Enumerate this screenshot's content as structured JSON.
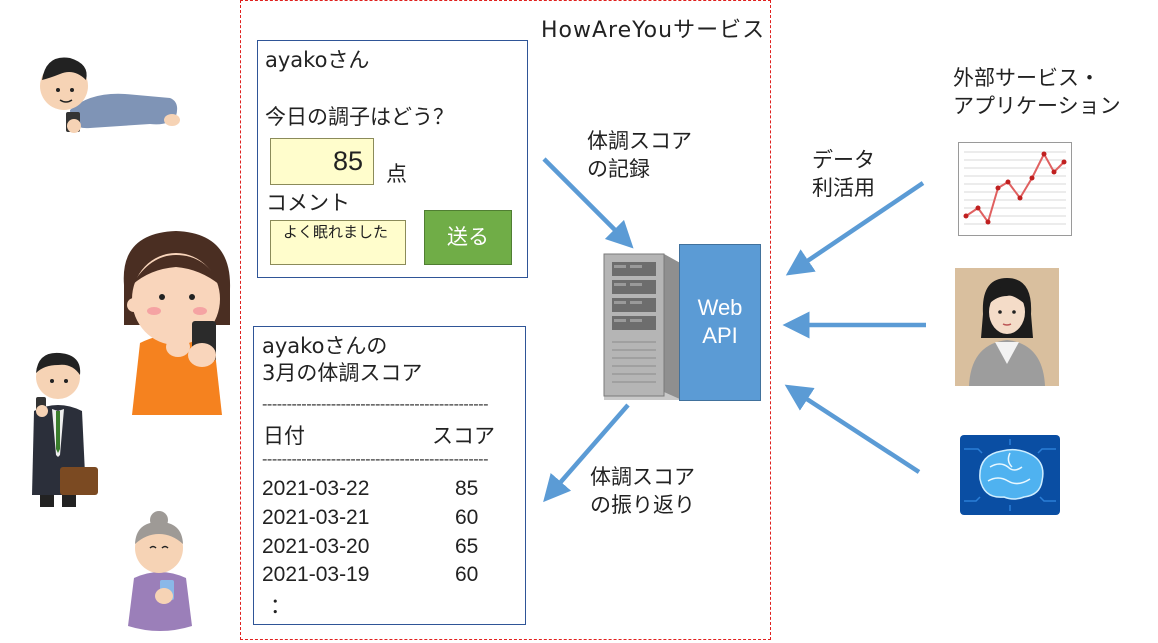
{
  "service": {
    "title": "HowAreYouサービス"
  },
  "input_form": {
    "greeting": "ayakoさん",
    "question": "今日の調子はどう？",
    "score_value": "85",
    "score_unit": "点",
    "comment_label": "コメント",
    "comment_value": "よく眠れました",
    "send_label": "送る"
  },
  "history": {
    "title": "ayakoさんの\n3月の体調スコア",
    "divider": "----------------------------------------------",
    "col_date": "日付",
    "col_score": "スコア",
    "rows": [
      {
        "date": "2021-03-22",
        "score": "85"
      },
      {
        "date": "2021-03-21",
        "score": "60"
      },
      {
        "date": "2021-03-20",
        "score": "65"
      },
      {
        "date": "2021-03-19",
        "score": "60"
      }
    ],
    "more": "："
  },
  "server": {
    "label": "Web\nAPI"
  },
  "flows": {
    "record": "体調スコア\nの記録",
    "review": "体調スコア\nの振り返り",
    "data_use": "データ\n利活用"
  },
  "external": {
    "title": "外部サービス・\nアプリケーション"
  },
  "colors": {
    "arrow": "#5b9bd5",
    "frame_border": "#e0201e",
    "panel_border": "#2f5597",
    "input_bg": "#fffdcc",
    "send_button": "#70ad47",
    "server_box": "#5b9bd5"
  }
}
